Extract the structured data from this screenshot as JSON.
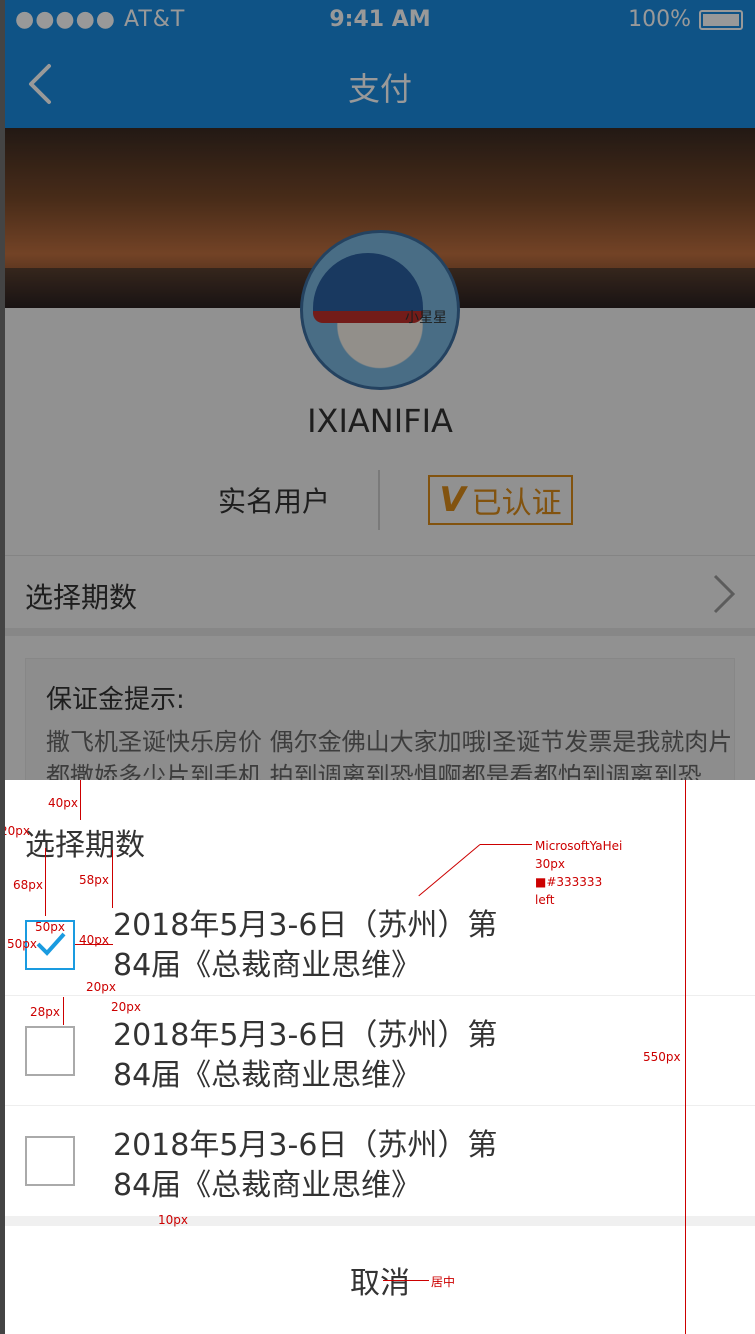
{
  "status": {
    "carrier": "●●●●● AT&T",
    "time": "9:41 AM",
    "battery": "100%"
  },
  "nav": {
    "title": "支付"
  },
  "profile": {
    "username": "IXIANIFIA",
    "real_name": "实名用户",
    "verified": "已认证",
    "avatar_tag": "小星星"
  },
  "period": {
    "label": "选择期数"
  },
  "tip": {
    "title": "保证金提示:",
    "body": "撒飞机圣诞快乐房价 偶尔金佛山大家加哦l圣诞节发票是我就肉片都撒娇多少片到手机 拍到调离到恐惧啊都是看都怕到调离到恐"
  },
  "sheet": {
    "heading": "选择期数",
    "options": [
      {
        "text": "2018年5月3-6日（苏州）第84届《总裁商业思维》",
        "checked": true
      },
      {
        "text": "2018年5月3-6日（苏州）第84届《总裁商业思维》",
        "checked": false
      },
      {
        "text": "2018年5月3-6日（苏州）第84届《总裁商业思维》",
        "checked": false
      }
    ],
    "cancel": "取消"
  },
  "annotations": {
    "a40": "40px",
    "a20": "20px",
    "a68": "68px",
    "a58": "58px",
    "a50w": "50px",
    "a50h": "50px",
    "a40b": "40px",
    "a20b": "20px",
    "a20c": "20px",
    "a28": "28px",
    "a10": "10px",
    "a550": "550px",
    "font": "MicrosoftYaHei",
    "size": "30px",
    "color": "■#333333",
    "align": "left",
    "center": "居中"
  },
  "colors": {
    "primary": "#1a8be0",
    "accent": "#d98a1a",
    "check": "#1a9be0"
  }
}
